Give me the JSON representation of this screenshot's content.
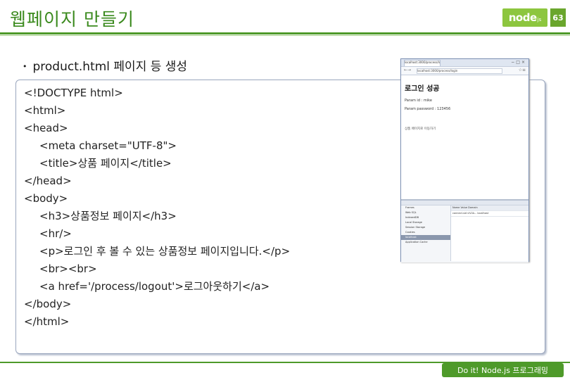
{
  "header": {
    "title": "웹페이지 만들기",
    "logo": "node",
    "logo_sub": "js",
    "page_number": "63"
  },
  "bullet": "product.html 페이지 등 생성",
  "code_lines": [
    "<!DOCTYPE html>",
    "<html>",
    "<head>",
    "<meta charset=\"UTF-8\">",
    "<title>상품 페이지</title>",
    "</head>",
    "<body>",
    "<h3>상품정보 페이지</h3>",
    "<hr/>",
    "<p>로그인 후 볼 수 있는 상품정보 페이지입니다.</p>",
    "<br><br>",
    "<a href='/process/logout'>로그아웃하기</a>",
    "</body>",
    "</html>"
  ],
  "screenshot": {
    "tab_title": "localhost:3000/process/login",
    "url": "localhost:3000/process/login",
    "heading": "로그인 성공",
    "param_id": "Param id : mike",
    "param_password": "Param password : 123456",
    "footer_text": "상품 페이지로 이동하기",
    "dev_side": [
      "Frames",
      "Web SQL",
      "IndexedDB",
      "Local Storage",
      "Session Storage",
      "Cookies",
      "localhost",
      "Application Cache"
    ],
    "dev_rows": [
      "Name  Value  Domain",
      "connect.sid  s%3A...  localhost"
    ]
  },
  "footer": "Do it! Node.js 프로그래밍"
}
